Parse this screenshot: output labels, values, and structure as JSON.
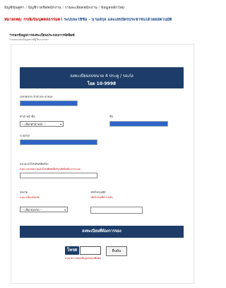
{
  "breadcrumb": {
    "items": [
      "บัญชีหุ้นคู่ค้า",
      "บัญชีรายชื่อพนักงาน",
      "รายละเอียดพนักงาน",
      "ข้อมูลหลักใหม่"
    ],
    "sep": "/"
  },
  "notice": {
    "kw": "หมายเหตุ:",
    "text1": "กรณีเป็นบุคคลธรรมดา ",
    "text2": "ระบบจะใช้ชื่อ - นามสกุล และเลขบัตรประชาชนได้โดยอัตโนมัติ"
  },
  "section": {
    "title": "*กรอกข้อมูลการลงทะเบียนประกอบการจัดพิมพ์",
    "note": "ระบบจะแสดงข้อมูลตามที่ผู้ใช้งานกรอก"
  },
  "header": {
    "line1": "ลงทะเบียนรถขนาด 4 ประตู / รถเก๋ง",
    "line2": "โฮต 10-9998"
  },
  "fields": {
    "idcard_label": "เลขบัตรประจำตัวประชาชน",
    "prefix_label": "คำนำหน้าชื่อ",
    "prefix_value": "-- เลือกคำนำหน้า --",
    "name_label": "ชื่อ",
    "surname_label": "นามสกุล",
    "phone_label": "หมายเลขโทรศัพท์มือถือ",
    "phone_warn": "กรุณากรอกหมายเลขโทรศัพท์เพื่อรับรหัสยืนยันจากระบบ",
    "province_label": "จังหวัด",
    "province_warn": "กรุณาเลือกจังหวัด",
    "province_value": "-- เลือกจังหวัด --",
    "postcode_label": "รหัสไปรษณีย์",
    "postcode_warn": "รหัสไปรษณีย์ 5 หลัก"
  },
  "band": {
    "label": "ลงทะเบียนที่ต้องการจอง"
  },
  "booking": {
    "pill": "โทรศ",
    "ok": "ยืนยัน",
    "warn": "กรุณาตรวจสอบข้อมูลก่อนกดยืนยัน"
  },
  "colors": {
    "navy": "#1d3d68",
    "input_fill": "#2e63c8",
    "warning": "#c00000"
  }
}
